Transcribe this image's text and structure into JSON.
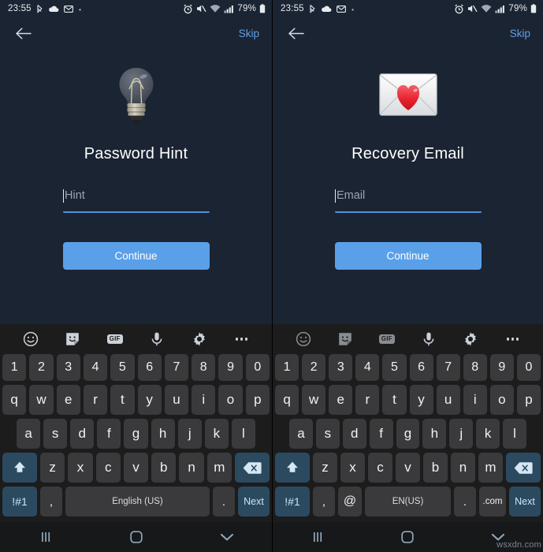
{
  "screens": [
    {
      "status_bar": {
        "time": "23:55",
        "left_icons": [
          "bluetooth-icon",
          "cloud-icon",
          "messages-icon",
          "dot-icon"
        ],
        "right_icons": [
          "alarm-icon",
          "mute-icon",
          "wifi-icon",
          "signal-icon"
        ],
        "battery": "79%"
      },
      "app_bar": {
        "back": "back-arrow-icon",
        "skip_label": "Skip"
      },
      "hero_icon": "lightbulb-icon",
      "title": "Password Hint",
      "field": {
        "placeholder": "Hint",
        "value": ""
      },
      "cta_label": "Continue",
      "keyboard": {
        "toolbar": [
          "emoji-icon",
          "sticker-icon",
          "gif-icon",
          "microphone-icon",
          "gear-icon",
          "overflow-icon"
        ],
        "gif_label": "GIF",
        "row_numbers": [
          "1",
          "2",
          "3",
          "4",
          "5",
          "6",
          "7",
          "8",
          "9",
          "0"
        ],
        "row_top": [
          "q",
          "w",
          "e",
          "r",
          "t",
          "y",
          "u",
          "i",
          "o",
          "p"
        ],
        "row_home": [
          "a",
          "s",
          "d",
          "f",
          "g",
          "h",
          "j",
          "k",
          "l"
        ],
        "row_bottom": [
          "z",
          "x",
          "c",
          "v",
          "b",
          "n",
          "m"
        ],
        "shift_label": "shift-icon",
        "backspace_label": "backspace-icon",
        "symbols_label": "!#1",
        "comma_label": ",",
        "space_label": "English (US)",
        "period_label": ".",
        "enter_label": "Next",
        "has_at_key": false,
        "has_dotcom_key": false
      },
      "nav_bar": [
        "recents-icon",
        "home-icon",
        "hide-keyboard-icon"
      ]
    },
    {
      "status_bar": {
        "time": "23:55",
        "left_icons": [
          "bluetooth-icon",
          "cloud-icon",
          "messages-icon",
          "dot-icon"
        ],
        "right_icons": [
          "alarm-icon",
          "mute-icon",
          "wifi-icon",
          "signal-icon"
        ],
        "battery": "79%"
      },
      "app_bar": {
        "back": "back-arrow-icon",
        "skip_label": "Skip"
      },
      "hero_icon": "love-letter-icon",
      "title": "Recovery Email",
      "field": {
        "placeholder": "Email",
        "value": ""
      },
      "cta_label": "Continue",
      "keyboard": {
        "toolbar": [
          "emoji-icon",
          "sticker-icon",
          "gif-icon",
          "microphone-icon",
          "gear-icon",
          "overflow-icon"
        ],
        "gif_label": "GIF",
        "row_numbers": [
          "1",
          "2",
          "3",
          "4",
          "5",
          "6",
          "7",
          "8",
          "9",
          "0"
        ],
        "row_top": [
          "q",
          "w",
          "e",
          "r",
          "t",
          "y",
          "u",
          "i",
          "o",
          "p"
        ],
        "row_home": [
          "a",
          "s",
          "d",
          "f",
          "g",
          "h",
          "j",
          "k",
          "l"
        ],
        "row_bottom": [
          "z",
          "x",
          "c",
          "v",
          "b",
          "n",
          "m"
        ],
        "shift_label": "shift-icon",
        "backspace_label": "backspace-icon",
        "symbols_label": "!#1",
        "comma_label": ",",
        "at_label": "@",
        "space_label": "EN(US)",
        "period_label": ".",
        "dotcom_label": ".com",
        "enter_label": "Next",
        "has_at_key": true,
        "has_dotcom_key": true
      },
      "nav_bar": [
        "recents-icon",
        "home-icon",
        "hide-keyboard-icon"
      ]
    }
  ],
  "watermark": "wsxdn.com",
  "colors": {
    "app_background": "#1b2433",
    "accent_blue": "#5aa0e8",
    "skip_blue": "#5ea0e8",
    "keyboard_background": "#1c1c1c",
    "key_background": "#3a3a3c",
    "key_accent_background": "#2b4a60",
    "nav_background": "#17181a"
  }
}
